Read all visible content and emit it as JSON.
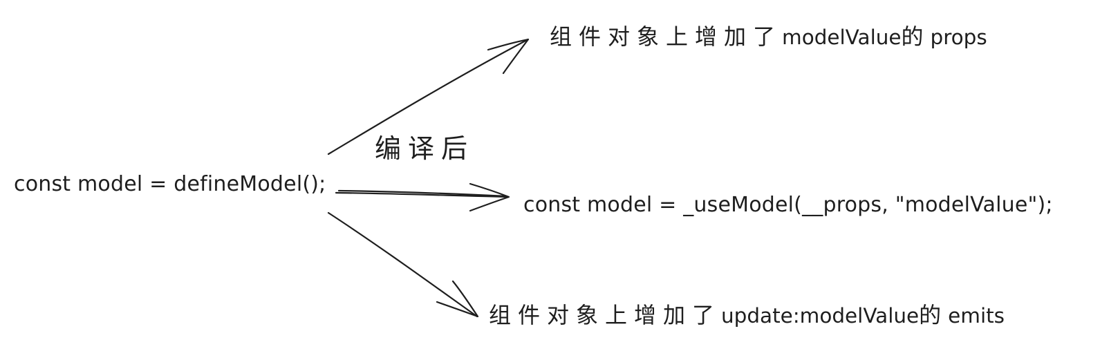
{
  "diagram": {
    "source_code": "const model = defineModel();",
    "compile_label": "编译后",
    "compiled_code": "const model = _useModel(__props, \"modelValue\");",
    "props_note": {
      "prefix": "组件对象上增加了",
      "keyword": "modelValue",
      "middle": "的",
      "suffix": "props"
    },
    "emits_note": {
      "prefix": "组件对象上增加了",
      "keyword": "update:modelValue",
      "middle": "的",
      "suffix": "emits"
    },
    "stroke_color": "#1e1e1e",
    "background_color": "#ffffff"
  }
}
